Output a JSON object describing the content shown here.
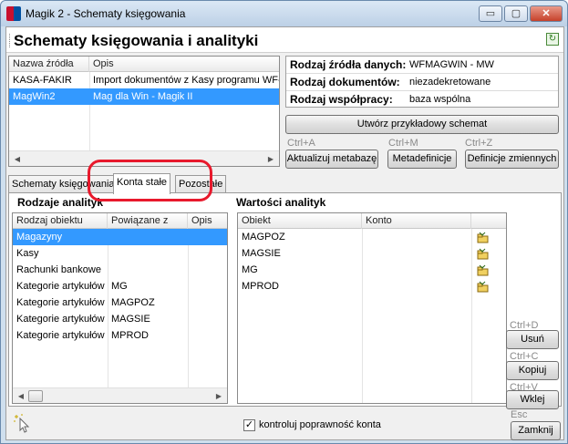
{
  "window": {
    "title": "Magik 2 - Schematy księgowania",
    "minimize_glyph": "▭",
    "maximize_glyph": "▢",
    "close_glyph": "✕",
    "header_title": "Schematy księgowania i analityki",
    "refresh_icon_glyph": "↻"
  },
  "sources_table": {
    "columns": [
      "Nazwa źródła",
      "Opis"
    ],
    "rows": [
      [
        "KASA-FAKIR",
        "Import dokumentów z Kasy programu WF-Fa"
      ],
      [
        "MagWin2",
        "Mag dla Win - Magik II"
      ]
    ],
    "selected_index": 1
  },
  "source_info": {
    "rows": [
      {
        "label": "Rodzaj źródła danych:",
        "value": "WFMAGWIN - MW"
      },
      {
        "label": "Rodzaj dokumentów:",
        "value": "niezadekretowane"
      },
      {
        "label": "Rodzaj współpracy:",
        "value": "baza wspólna"
      }
    ]
  },
  "actions": {
    "create_example": "Utwórz przykładowy schemat",
    "update_label": "Aktualizuj metabazę",
    "update_shortcut": "Ctrl+A",
    "metadef_label": "Metadefinicje",
    "metadef_shortcut": "Ctrl+M",
    "vars_label": "Definicje zmiennych",
    "vars_shortcut": "Ctrl+Z"
  },
  "tabs": [
    {
      "label": "Schematy księgowania",
      "active": false
    },
    {
      "label": "Konta stałe",
      "active": true
    },
    {
      "label": "Pozostałe",
      "active": false
    }
  ],
  "analytics_types": {
    "title": "Rodzaje analityk",
    "columns": [
      "Rodzaj obiektu",
      "Powiązane z",
      "Opis"
    ],
    "rows": [
      [
        "Magazyny",
        "",
        ""
      ],
      [
        "Kasy",
        "",
        ""
      ],
      [
        "Rachunki bankowe",
        "",
        ""
      ],
      [
        "Kategorie artykułów",
        "MG",
        ""
      ],
      [
        "Kategorie artykułów",
        "MAGPOZ",
        ""
      ],
      [
        "Kategorie artykułów",
        "MAGSIE",
        ""
      ],
      [
        "Kategorie artykułów",
        "MPROD",
        ""
      ]
    ],
    "selected_index": 0
  },
  "analytics_values": {
    "title": "Wartości analityk",
    "columns": [
      "Obiekt",
      "Konto"
    ],
    "rows": [
      [
        "MAGPOZ",
        ""
      ],
      [
        "MAGSIE",
        ""
      ],
      [
        "MG",
        ""
      ],
      [
        "MPROD",
        ""
      ]
    ]
  },
  "side_buttons": {
    "delete_label": "Usuń",
    "delete_shortcut": "Ctrl+D",
    "copy_label": "Kopiuj",
    "copy_shortcut": "Ctrl+C",
    "paste_label": "Wklej",
    "paste_shortcut": "Ctrl+V"
  },
  "footer": {
    "validate_label": "kontroluj poprawność konta",
    "validate_checked": true,
    "close_label": "Zamknij",
    "close_shortcut": "Esc"
  },
  "colors": {
    "selection": "#3399ff",
    "annotation": "#e8192c"
  }
}
